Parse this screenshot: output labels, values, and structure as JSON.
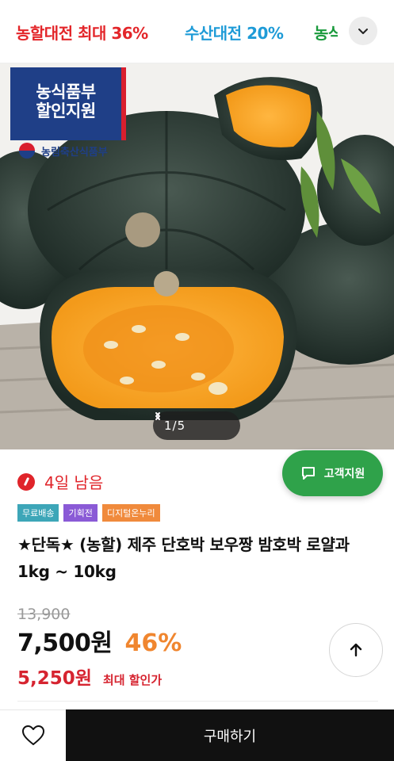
{
  "promo_bar": {
    "items": [
      {
        "label": "농할대전 최대 36%",
        "color": "#e3262a"
      },
      {
        "label": "수산대전 20%",
        "color": "#1e9bd7"
      },
      {
        "label": "농식",
        "color": "#1a9a3c"
      }
    ],
    "more_icon": "chevron-down-icon"
  },
  "hero": {
    "badge_line1": "농식품부",
    "badge_line2": "할인지원",
    "ministry_name": "농림축산식품부",
    "pager_current": "1",
    "pager_total": "5",
    "pager_text": "1/5"
  },
  "deadline": {
    "text": "4일 남음",
    "color": "#e0242a"
  },
  "support_button": {
    "label": "고객지원",
    "icon": "chat-icon"
  },
  "tags": [
    "무료배송",
    "기획전",
    "디지털온누리"
  ],
  "product": {
    "title": "★단독★ (농할) 제주 단호박 보우짱 밤호박 로얄과 1kg ~ 10kg",
    "original_price": "13,900",
    "price": "7,500원",
    "discount": "46%",
    "min_price": "5,250원",
    "min_price_label": "최대 할인가"
  },
  "scroll_top_icon": "arrow-up-icon",
  "bottom_bar": {
    "wish_icon": "heart-icon",
    "buy_label": "구매하기"
  },
  "colors": {
    "accent_red": "#e0242a",
    "accent_green": "#2fa24a",
    "discount_orange": "#f0862f",
    "buy_button": "#111111"
  }
}
